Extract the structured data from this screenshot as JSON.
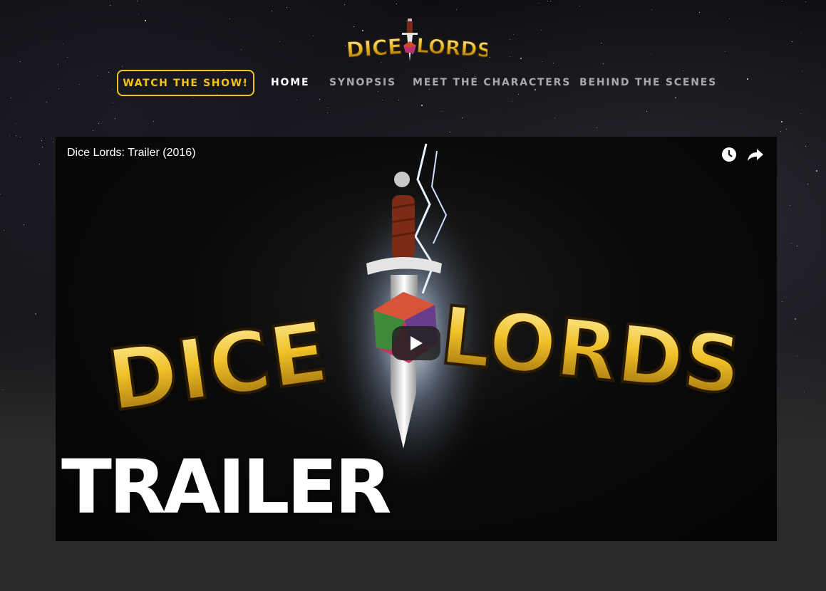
{
  "logo": {
    "text": "DICE LORDS",
    "brand_color": "#f2c318"
  },
  "nav": {
    "watch_label": "WATCH THE SHOW!",
    "items": [
      {
        "label": "HOME",
        "active": true
      },
      {
        "label": "SYNOPSIS",
        "active": false
      },
      {
        "label": "MEET THE CHARACTERS",
        "active": false
      },
      {
        "label": "BEHIND THE SCENES",
        "active": false
      }
    ]
  },
  "video": {
    "title": "Dice Lords: Trailer (2016)",
    "thumbnail_text": "TRAILER",
    "logo_left": "DICE",
    "logo_right": "LORDS",
    "icons": [
      "watch-later-icon",
      "share-icon",
      "play-icon"
    ]
  },
  "colors": {
    "accent": "#f2c318",
    "nav_inactive": "#a9a9a9",
    "nav_active": "#ffffff"
  }
}
